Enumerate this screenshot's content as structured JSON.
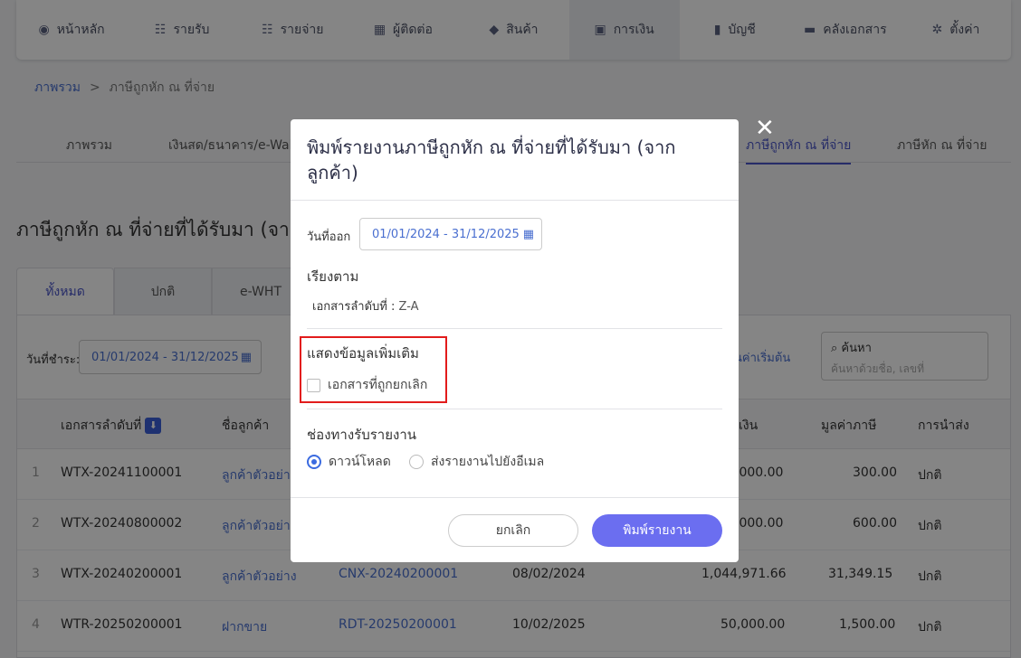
{
  "nav": {
    "items": [
      {
        "label": "หน้าหลัก",
        "icon": "◉"
      },
      {
        "label": "รายรับ",
        "icon": "☷"
      },
      {
        "label": "รายจ่าย",
        "icon": "☷"
      },
      {
        "label": "ผู้ติดต่อ",
        "icon": "▦"
      },
      {
        "label": "สินค้า",
        "icon": "◆"
      },
      {
        "label": "การเงิน",
        "icon": "▣"
      },
      {
        "label": "บัญชี",
        "icon": "▮"
      },
      {
        "label": "คลังเอกสาร",
        "icon": "▬"
      },
      {
        "label": "ตั้งค่า",
        "icon": "✲"
      }
    ]
  },
  "breadcrumb": {
    "root": "ภาพรวม",
    "sep": ">",
    "current": "ภาษีถูกหัก ณ ที่จ่าย"
  },
  "subtabs": [
    "ภาพรวม",
    "เงินสด/ธนาคาร/e-Wallet",
    "ภาษีถูกหัก ณ ที่จ่าย",
    "ภาษีหัก ณ ที่จ่าย"
  ],
  "page": {
    "title": "ภาษีถูกหัก ณ ที่จ่ายที่ได้รับมา (จาก"
  },
  "filter_tabs": [
    "ทั้งหมด",
    "ปกติ",
    "e-WHT"
  ],
  "filters": {
    "date_label": "วันที่ชำระ:",
    "date_range": "01/01/2024 - 31/12/2025",
    "reset": "ันค่าเริ่มต้น",
    "search_label": "ค้นหา",
    "search_placeholder": "ค้นหาด้วยชื่อ, เลขที่"
  },
  "table": {
    "headers": {
      "doc": "เอกสารลำดับที่",
      "customer": "ชื่อลูกค้า",
      "amount": "เงิน",
      "tax": "มูลค่าภาษี",
      "delivery": "การนำส่ง"
    },
    "rows": [
      {
        "no": "1",
        "doc": "WTX-20241100001",
        "customer": "ลูกค้าตัวอย่า",
        "ref": "",
        "date": "",
        "amount": ",000.00",
        "tax": "300.00",
        "delivery": "ปกติ"
      },
      {
        "no": "2",
        "doc": "WTX-20240800002",
        "customer": "ลูกค้าตัวอย่า",
        "ref": "",
        "date": "",
        "amount": ",000.00",
        "tax": "600.00",
        "delivery": "ปกติ"
      },
      {
        "no": "3",
        "doc": "WTX-20240200001",
        "customer": "ลูกค้าตัวอย่าง",
        "ref": "CNX-20240200001",
        "date": "08/02/2024",
        "amount": "1,044,971.66",
        "tax": "31,349.15",
        "delivery": "ปกติ"
      },
      {
        "no": "4",
        "doc": "WTR-20250200001",
        "customer": "ฝากขาย",
        "ref": "RDT-20250200001",
        "date": "10/02/2025",
        "amount": "50,000.00",
        "tax": "1,500.00",
        "delivery": "ปกติ"
      }
    ]
  },
  "modal": {
    "title": "พิมพ์รายงานภาษีถูกหัก ณ ที่จ่ายที่ได้รับมา (จากลูกค้า)",
    "close": "✕",
    "date_label": "วันที่ออก",
    "date_range": "01/01/2024 - 31/12/2025",
    "sort_title": "เรียงตาม",
    "sort_field": "เอกสารลำดับที่ :",
    "sort_value": "Z-A",
    "extra_title": "แสดงข้อมูลเพิ่มเติม",
    "extra_checkbox": "เอกสารที่ถูกยกเลิก",
    "channel_title": "ช่องทางรับรายงาน",
    "channel_download": "ดาวน์โหลด",
    "channel_email": "ส่งรายงานไปยังอีเมล",
    "cancel": "ยกเลิก",
    "print": "พิมพ์รายงาน"
  }
}
